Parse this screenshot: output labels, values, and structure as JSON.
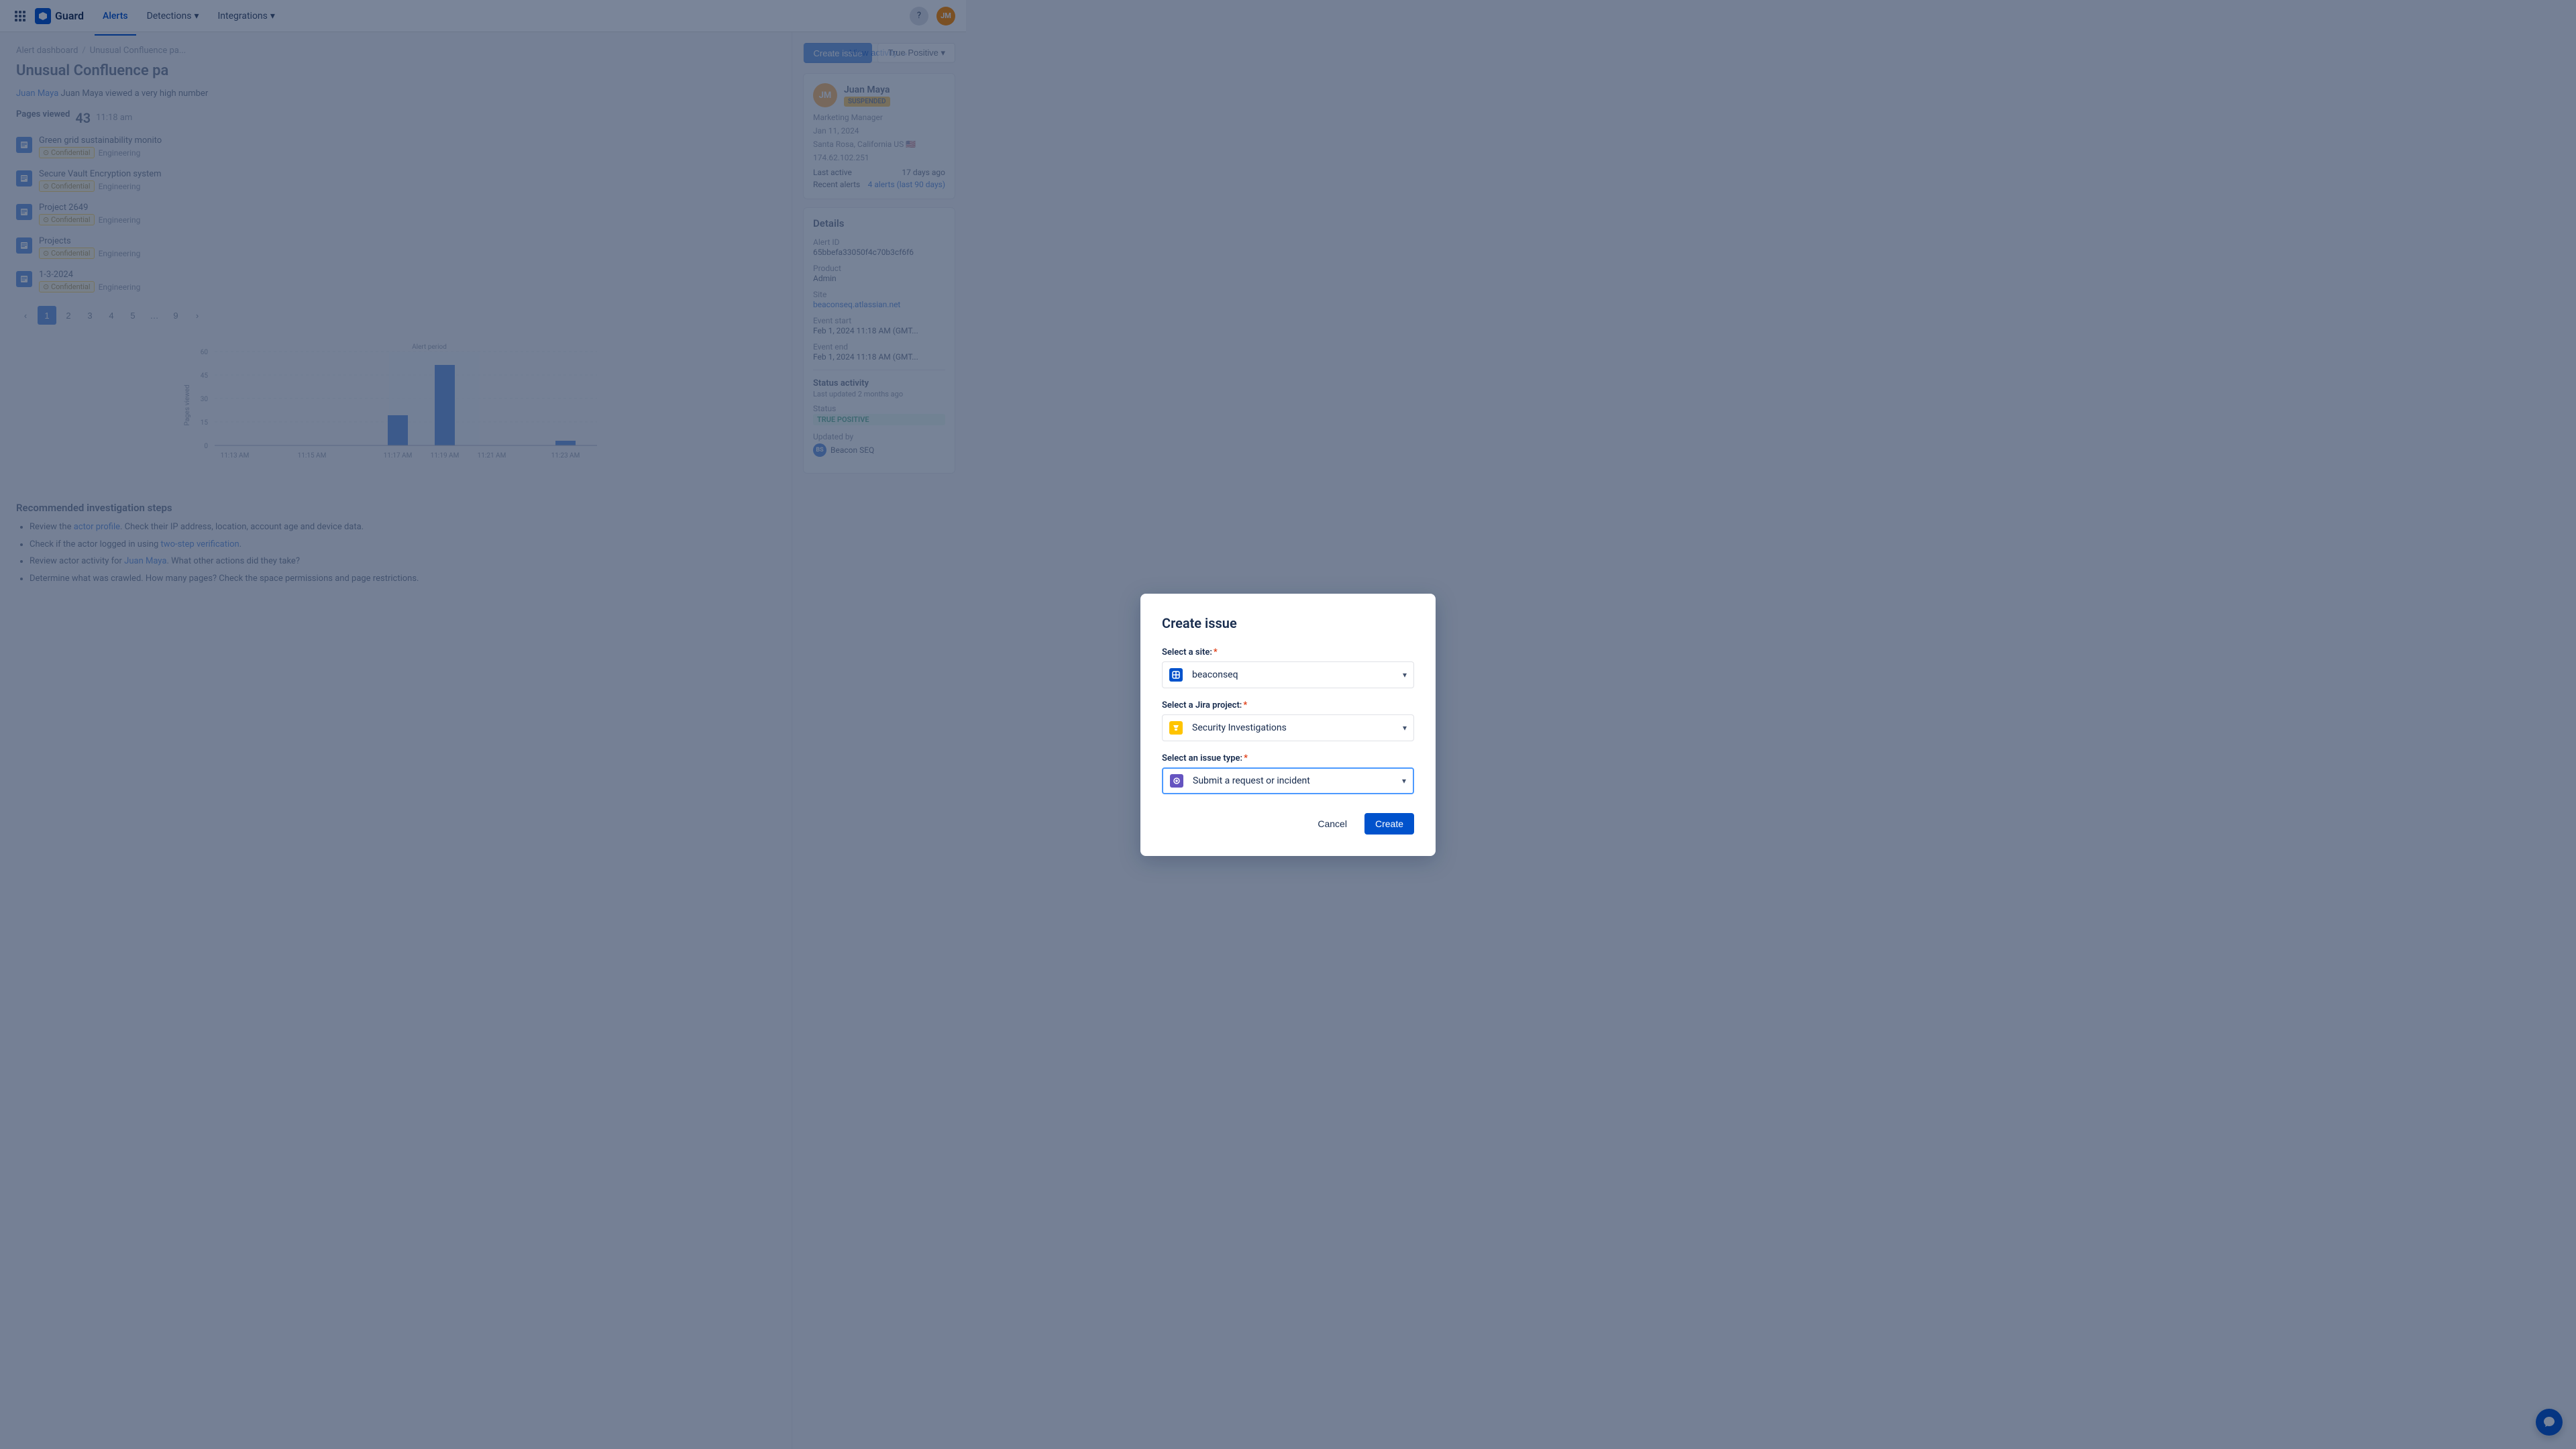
{
  "nav": {
    "app_name": "Guard",
    "current_user": "JM",
    "links": [
      {
        "id": "alerts",
        "label": "Alerts",
        "active": true
      },
      {
        "id": "detections",
        "label": "Detections",
        "has_arrow": true
      },
      {
        "id": "integrations",
        "label": "Integrations",
        "has_arrow": true
      }
    ]
  },
  "breadcrumb": {
    "items": [
      "Alert dashboard",
      "Unusual Confluence pa..."
    ]
  },
  "page": {
    "title": "Unusual Confluence pa",
    "alert_summary": "Juan Maya viewed a very high number",
    "pages_viewed_label": "Pages viewed",
    "pages_viewed_count": "43",
    "pages_viewed_time": "11:18 am"
  },
  "page_list": [
    {
      "name": "Green grid sustainability monito",
      "tags": [
        "Confidential",
        "Engineering"
      ]
    },
    {
      "name": "Secure Vault Encryption system",
      "tags": [
        "Confidential",
        "Engineering"
      ]
    },
    {
      "name": "Project 2649",
      "tags": [
        "Confidential",
        "Engineering"
      ]
    },
    {
      "name": "Projects",
      "tags": [
        "Confidential",
        "Engineering"
      ]
    },
    {
      "name": "1-3-2024",
      "tags": [
        "Confidential",
        "Engineering"
      ]
    }
  ],
  "pagination": {
    "pages": [
      "1",
      "2",
      "3",
      "4",
      "5",
      "...",
      "9"
    ],
    "active": "1"
  },
  "chart": {
    "y_label": "Pages viewed",
    "x_labels": [
      "11:13 AM",
      "11:15 AM",
      "11:17 AM",
      "11:19 AM",
      "11:21 AM",
      "11:23 AM"
    ],
    "y_max": 60,
    "y_ticks": [
      0,
      15,
      30,
      45,
      60
    ],
    "alert_period_label": "Alert period",
    "bars": [
      {
        "time": "11:13 AM",
        "value": 0
      },
      {
        "time": "11:15 AM",
        "value": 0
      },
      {
        "time": "11:17 AM",
        "value": 18
      },
      {
        "time": "11:19 AM",
        "value": 48
      },
      {
        "time": "11:21 AM",
        "value": 0
      },
      {
        "time": "11:23 AM",
        "value": 3
      }
    ]
  },
  "recommended": {
    "title": "Recommended investigation steps",
    "steps": [
      "Review the actor profile. Check their IP address, location, account age and device data.",
      "Check if the actor logged in using two-step verification.",
      "Review actor activity for Juan Maya. What other actions did they take?",
      "Determine what was crawled. How many pages? Check the space permissions and page restrictions."
    ],
    "links": {
      "actor_profile": "actor profile",
      "two_step": "two-step verification",
      "juan_maya": "Juan Maya"
    }
  },
  "right_panel": {
    "view_activity_label": "View activity →",
    "user": {
      "name": "Juan Maya",
      "badge": "SUSPENDED",
      "role": "Marketing Manager",
      "date": "Jan 11, 2024",
      "location": "Santa Rosa, California US 🇺🇸",
      "ip": "174.62.102.251",
      "last_active_label": "Last active",
      "last_active_value": "17 days ago",
      "recent_alerts_label": "Recent alerts",
      "recent_alerts_value": "4 alerts (last 90 days)"
    },
    "details": {
      "title": "Details",
      "alert_id_label": "Alert ID",
      "alert_id_value": "65bbefa33050f4c70b3cf6f6",
      "product_label": "Product",
      "product_value": "Admin",
      "site_label": "Site",
      "site_value": "beaconseq.atlassian.net",
      "event_start_label": "Event start",
      "event_start_value": "Feb 1, 2024 11:18 AM (GMT...",
      "event_end_label": "Event end",
      "event_end_value": "Feb 1, 2024 11:18 AM (GMT...",
      "status_activity_title": "Status activity",
      "last_updated": "Last updated 2 months ago",
      "status_label": "Status",
      "status_value": "TRUE POSITIVE",
      "updated_by_label": "Updated by",
      "updated_by_value": "Beacon SEQ"
    }
  },
  "actions": {
    "create_issue_label": "Create issue",
    "true_positive_label": "True Positive ▾"
  },
  "modal": {
    "title": "Create issue",
    "site_label": "Select a site:",
    "site_required": true,
    "site_value": "beaconseq",
    "project_label": "Select a Jira project:",
    "project_required": true,
    "project_value": "Security Investigations",
    "issue_type_label": "Select an issue type:",
    "issue_type_required": true,
    "issue_type_value": "Submit a request or incident",
    "cancel_label": "Cancel",
    "create_label": "Create"
  }
}
